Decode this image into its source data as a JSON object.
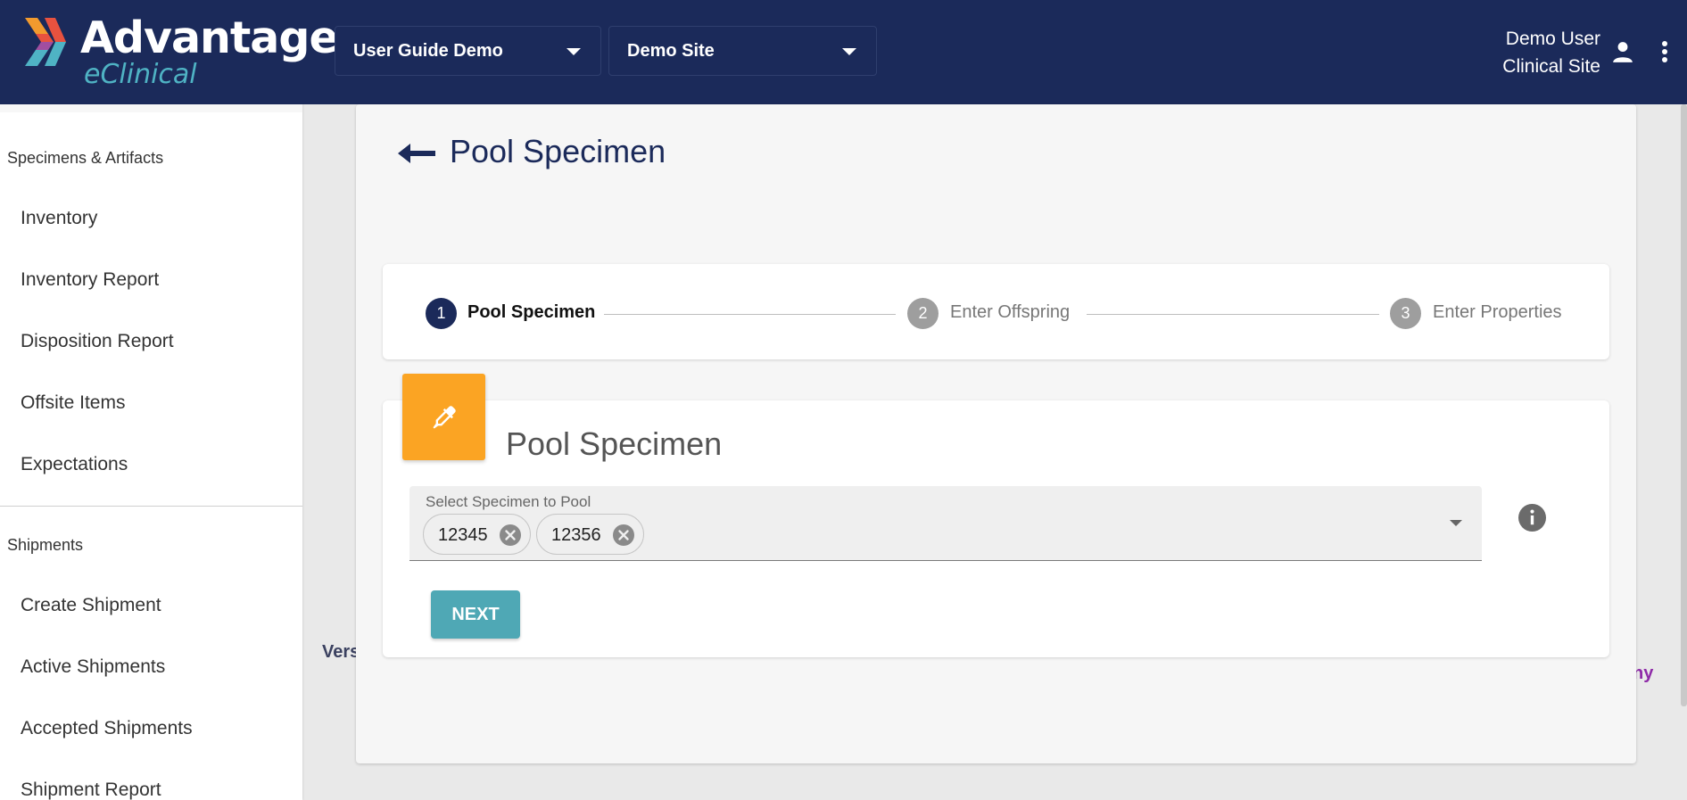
{
  "header": {
    "logo_title": "Advantage",
    "logo_subtitle": "eClinical",
    "study_select": "User Guide Demo",
    "site_select": "Demo Site",
    "user_name": "Demo User",
    "user_role": "Clinical Site"
  },
  "sidebar": {
    "section1": "Specimens & Artifacts",
    "items1": [
      "Inventory",
      "Inventory Report",
      "Disposition Report",
      "Offsite Items",
      "Expectations"
    ],
    "section2": "Shipments",
    "items2": [
      "Create Shipment",
      "Active Shipments",
      "Accepted Shipments",
      "Shipment Report"
    ]
  },
  "footer": {
    "left_fragment": "Vers",
    "right_fragment": "ny"
  },
  "page": {
    "title": "Pool Specimen"
  },
  "stepper": {
    "steps": [
      {
        "number": "1",
        "label": "Pool Specimen",
        "state": "active"
      },
      {
        "number": "2",
        "label": "Enter Offspring",
        "state": "inactive"
      },
      {
        "number": "3",
        "label": "Enter Properties",
        "state": "inactive"
      }
    ]
  },
  "pool_form": {
    "icon": "pipette-icon",
    "title": "Pool Specimen",
    "select_label": "Select Specimen to Pool",
    "chips": [
      "12345",
      "12356"
    ],
    "next_label": "NEXT"
  },
  "colors": {
    "header_bg": "#1b2a5a",
    "accent_orange": "#fba423",
    "button_teal": "#4fa8b5",
    "logo_teal": "#4fb3c4"
  }
}
